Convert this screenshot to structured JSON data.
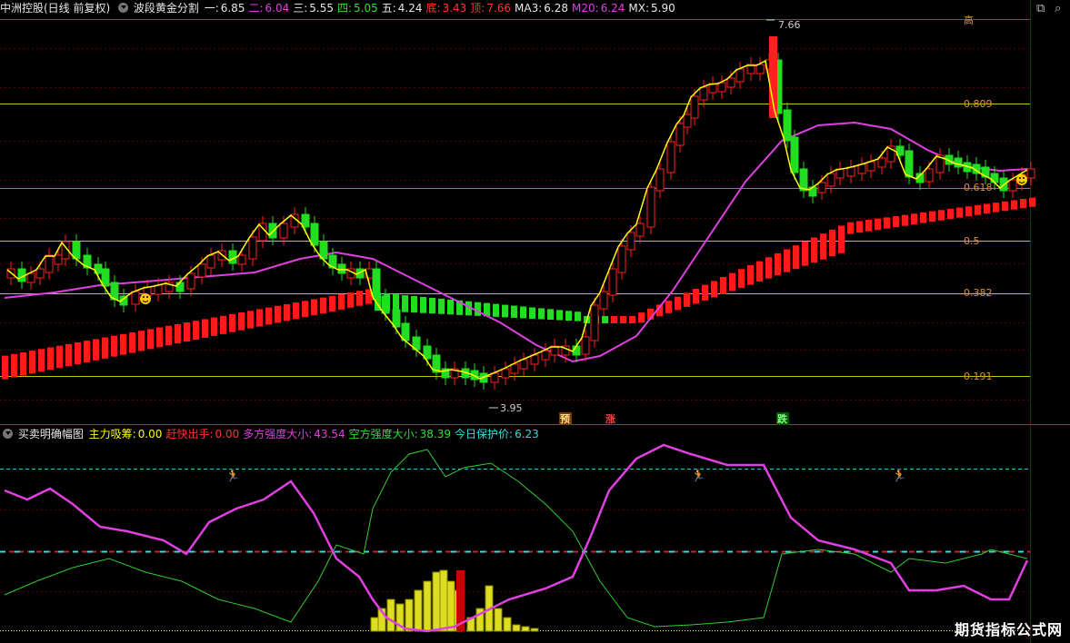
{
  "main_header": {
    "title": "中洲控股(日线 前复权)",
    "indicator": "波段黄金分割",
    "items": [
      {
        "label": "一:",
        "value": "6.85",
        "color": "#e8e8e8"
      },
      {
        "label": "二:",
        "value": "6.04",
        "color": "#e040e0"
      },
      {
        "label": "三:",
        "value": "5.55",
        "color": "#e8e8e8"
      },
      {
        "label": "四:",
        "value": "5.05",
        "color": "#33dd33"
      },
      {
        "label": "五:",
        "value": "4.24",
        "color": "#e8e8e8"
      },
      {
        "label": "底:",
        "value": "3.43",
        "color": "#ff3333"
      },
      {
        "label": "顶:",
        "value": "7.66",
        "color": "#ff3333"
      },
      {
        "label": "MA3:",
        "value": "6.28",
        "color": "#e8e8e8"
      },
      {
        "label": "M20:",
        "value": "6.24",
        "color": "#e040e0"
      },
      {
        "label": "MX:",
        "value": "5.90",
        "color": "#e8e8e8"
      }
    ]
  },
  "fib_labels": {
    "top": "高",
    "l809": "0.809",
    "l618": "0.618",
    "l5": "0.5",
    "l382": "0.382",
    "l191": "0.191"
  },
  "price_markers": {
    "high": "7.66",
    "low": "3.95"
  },
  "signals": {
    "yu": "预",
    "zhang": "涨",
    "die": "跌"
  },
  "sub_header": {
    "title": "买卖明确幅图",
    "items": [
      {
        "label": "主力吸筹:",
        "value": "0.00",
        "color": "#ffff00"
      },
      {
        "label": "赶快出手:",
        "value": "0.00",
        "color": "#ff3333"
      },
      {
        "label": "多方强度大小:",
        "value": "43.54",
        "color": "#e040e0"
      },
      {
        "label": "空方强度大小:",
        "value": "38.39",
        "color": "#33dd33"
      },
      {
        "label": "今日保护价:",
        "value": "6.23",
        "color": "#33dddd"
      }
    ]
  },
  "watermark": "期货指标公式网",
  "colors": {
    "up": "#ff2020",
    "down": "#22dd22",
    "ma": "#ffff00",
    "m20": "#e040e0",
    "grid": "#8b0000"
  }
}
